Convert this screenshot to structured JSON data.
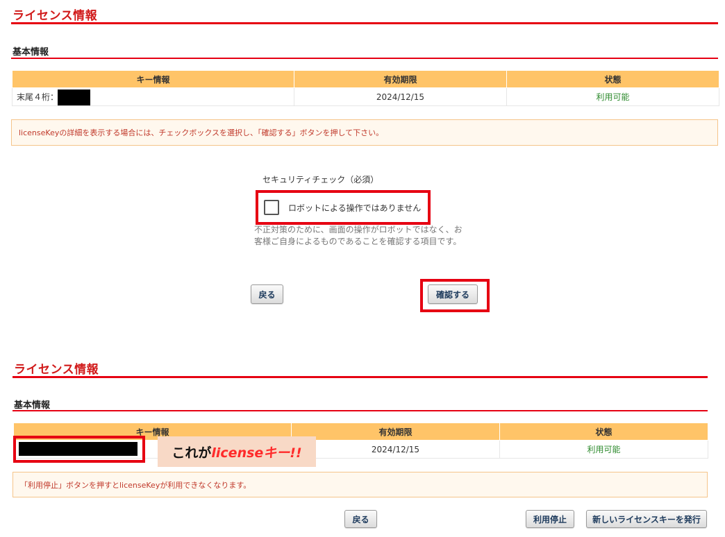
{
  "top": {
    "section_title": "ライセンス情報",
    "sub_title": "基本情報",
    "table": {
      "headers": [
        "キー情報",
        "有効期限",
        "状態"
      ],
      "row": {
        "key": "末尾４桁：",
        "expiry": "2024/12/15",
        "status": "利用可能"
      }
    },
    "notice": "licenseKeyの詳細を表示する場合には、チェックボックスを選択し、「確認する」ボタンを押して下さい。",
    "security": {
      "title": "セキュリティチェック（必須）",
      "checkbox_label": "ロボットによる操作ではありません",
      "checked": false,
      "description_line1": "不正対策のために、画面の操作がロボットではなく、お",
      "description_line2": "客様ご自身によるものであることを確認する項目です。"
    },
    "back_label": "戻る",
    "confirm_label": "確認する"
  },
  "bottom": {
    "section_title": "ライセンス情報",
    "sub_title": "基本情報",
    "table": {
      "headers": [
        "キー情報",
        "有効期限",
        "状態"
      ],
      "row": {
        "expiry": "2024/12/15",
        "status": "利用可能"
      }
    },
    "callout_prefix": "これが",
    "callout_emph": "licenseキー!!",
    "notice": "「利用停止」ボタンを押すとlicenseKeyが利用できなくなります。",
    "back_label": "戻る",
    "suspend_label": "利用停止",
    "new_key_label": "新しいライセンスキーを発行"
  },
  "colors": {
    "accent_red": "#e60012",
    "header_orange": "#ffc468",
    "status_green": "#2e8b2e",
    "notice_bg": "#fff8ee"
  }
}
